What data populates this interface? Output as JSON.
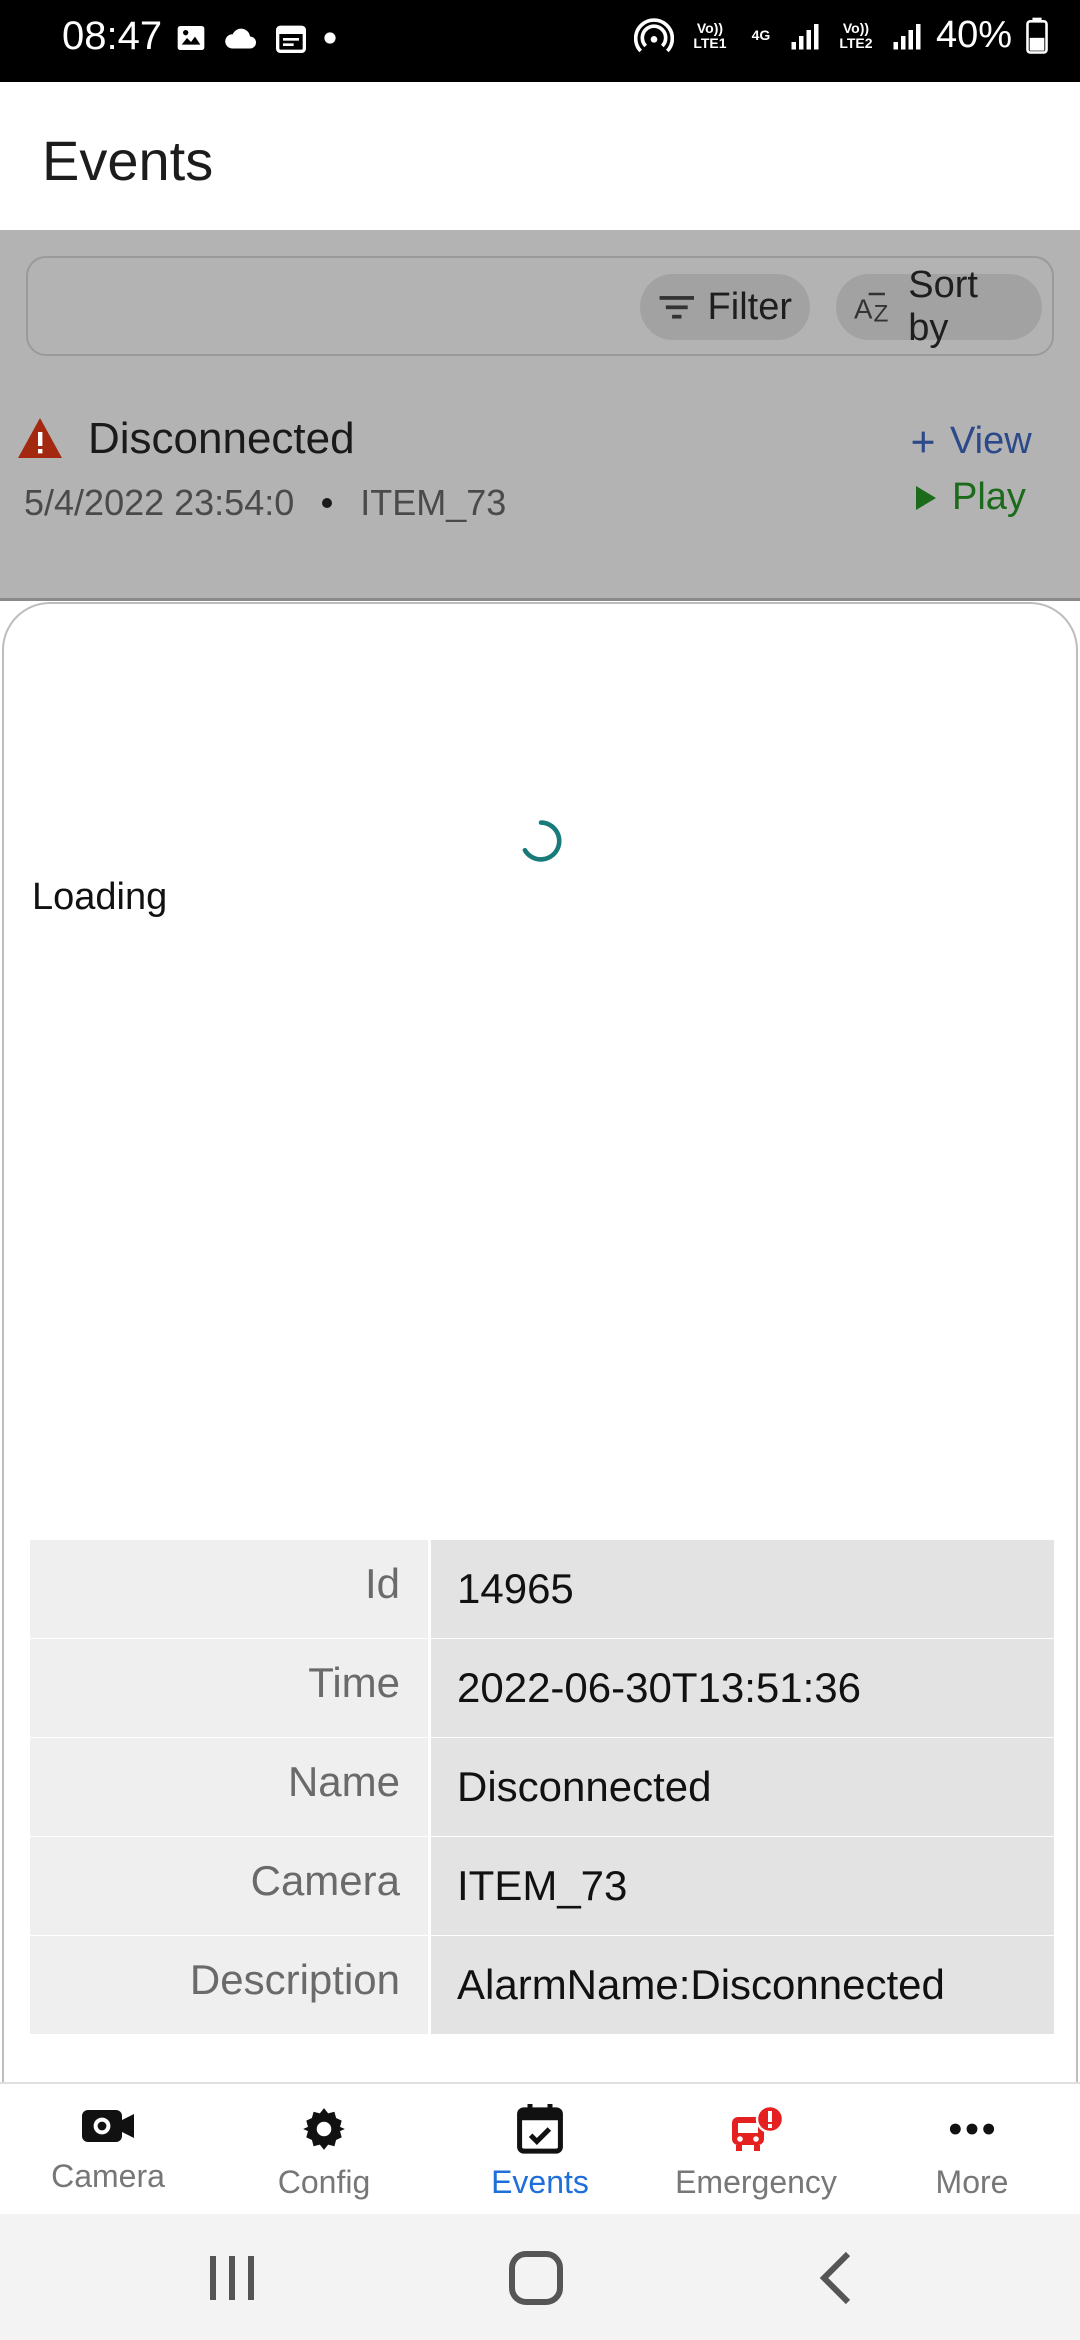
{
  "status_bar": {
    "time": "08:47",
    "battery": "40%",
    "sim1_label": "Vo)) LTE1",
    "sim2_label": "Vo)) LTE2",
    "network": "4G"
  },
  "header": {
    "title": "Events"
  },
  "toolbar": {
    "filter_label": "Filter",
    "sort_label": "Sort by"
  },
  "event": {
    "name": "Disconnected",
    "datetime": "5/4/2022 23:54:0",
    "camera": "ITEM_73",
    "view_label": "View",
    "play_label": "Play"
  },
  "sheet": {
    "loading_text": "Loading",
    "details": [
      {
        "label": "Id",
        "value": "14965"
      },
      {
        "label": "Time",
        "value": "2022-06-30T13:51:36"
      },
      {
        "label": "Name",
        "value": "Disconnected"
      },
      {
        "label": "Camera",
        "value": "ITEM_73"
      },
      {
        "label": "Description",
        "value": "AlarmName:Disconnected"
      }
    ]
  },
  "bottom_nav": {
    "items": [
      {
        "label": "Camera",
        "icon": "camera-icon"
      },
      {
        "label": "Config",
        "icon": "gear-icon"
      },
      {
        "label": "Events",
        "icon": "calendar-check-icon",
        "active": true
      },
      {
        "label": "Emergency",
        "icon": "emergency-icon"
      },
      {
        "label": "More",
        "icon": "more-dots-icon"
      }
    ]
  },
  "colors": {
    "accent": "#1e6fd9",
    "warning": "#a3280f",
    "play": "#1b6b1b",
    "view": "#2c4a8a",
    "spinner": "#1a7a7a",
    "emergency": "#e52020"
  }
}
